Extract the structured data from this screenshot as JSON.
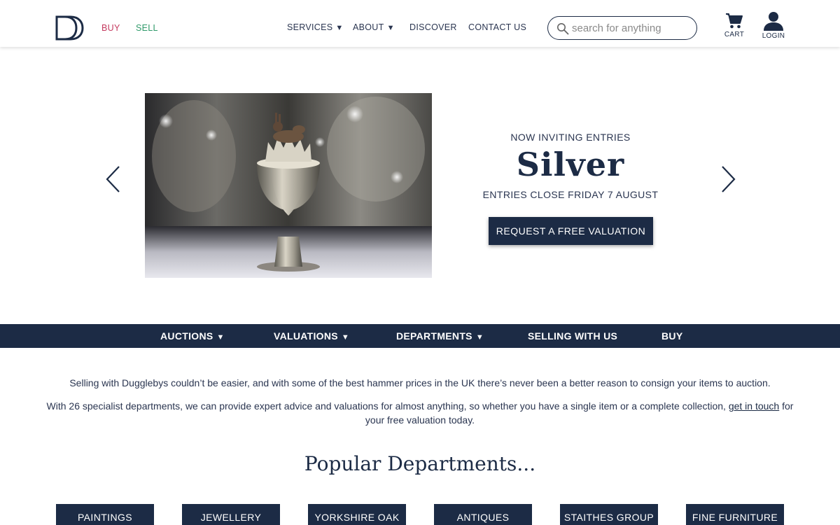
{
  "header": {
    "buy_label": "BUY",
    "sell_label": "SELL",
    "nav": [
      {
        "label": "SERVICES",
        "dropdown": true
      },
      {
        "label": "ABOUT",
        "dropdown": true
      },
      {
        "label": "DISCOVER",
        "dropdown": false
      },
      {
        "label": "CONTACT US",
        "dropdown": false
      }
    ],
    "caret": "▼",
    "search_placeholder": "search for anything",
    "cart_label": "CART",
    "login_label": "LOGIN"
  },
  "hero": {
    "kicker": "NOW INVITING ENTRIES",
    "title": "Silver",
    "subtitle": "ENTRIES CLOSE FRIDAY 7 AUGUST",
    "cta_label": "REQUEST A FREE VALUATION"
  },
  "subnav": {
    "items": [
      {
        "label": "AUCTIONS",
        "dropdown": true
      },
      {
        "label": "VALUATIONS",
        "dropdown": true
      },
      {
        "label": "DEPARTMENTS",
        "dropdown": true
      },
      {
        "label": "SELLING WITH US",
        "dropdown": false
      },
      {
        "label": "BUY",
        "dropdown": false
      }
    ]
  },
  "intro": {
    "paragraph1": "Selling with Dugglebys couldn’t be easier, and with some of the best hammer prices in the UK there’s never been a better reason to consign your items to auction.",
    "paragraph2_before": "With 26 specialist departments, we can provide expert advice and valuations for almost anything, so whether you have a single item or a complete collection,",
    "paragraph2_link": "get in touch",
    "paragraph2_after": "for your free valuation today."
  },
  "popular": {
    "title": "Popular Departments...",
    "departments": [
      "PAINTINGS",
      "JEWELLERY",
      "YORKSHIRE OAK",
      "ANTIQUES",
      "STAITHES GROUP",
      "FINE FURNITURE"
    ]
  },
  "colors": {
    "navy": "#1c2b45",
    "buy_accent": "#c43a5f",
    "sell_accent": "#2f9a6a"
  },
  "icons": [
    "logo-dd",
    "search-icon",
    "cart-icon",
    "user-icon",
    "chevron-left-icon",
    "chevron-right-icon",
    "caret-down-icon"
  ]
}
